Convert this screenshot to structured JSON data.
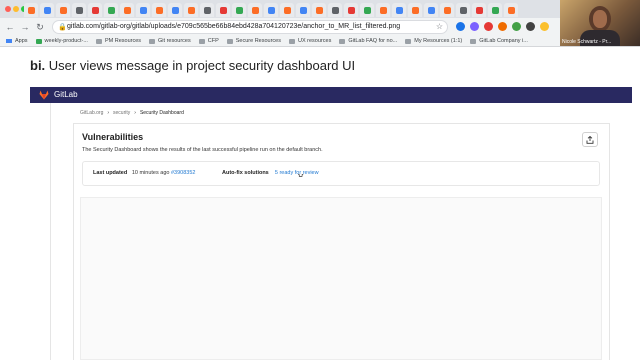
{
  "browser": {
    "url": "gitlab.com/gitlab-org/gitlab/uploads/e709c565be66b84ebd428a704120723e/anchor_to_MR_list_filtered.png",
    "bookmarks": [
      "Apps",
      "weekly-product-...",
      "PM Resources",
      "Git resources",
      "CFP",
      "Secure Resources",
      "UX resources",
      "GitLab FAQ for no...",
      "My Resources (1:1)",
      "GitLab Company i..."
    ],
    "tab_count": 31
  },
  "webcam": {
    "name": "Nicole Schwartz - Pr..."
  },
  "slide": {
    "number": "bi.",
    "title": "User views message in project security dashboard UI"
  },
  "gitlab": {
    "brand": "GitLab",
    "breadcrumb": [
      "GitLab.org",
      "security",
      "Security Dashboard"
    ],
    "heading": "Vulnerabilities",
    "description": "The Security Dashboard shows the results of the last successful pipeline run on the default branch.",
    "summary": {
      "last_updated_label": "Last updated",
      "last_updated_value": "10 minutes ago",
      "pipeline_link": "#3908352",
      "autofix_label": "Auto-fix solutions",
      "autofix_value": "5 ready for review"
    }
  },
  "colors": {
    "gitlab_nav": "#292961",
    "link": "#1f78d1",
    "tab_bar": "#dee1e6"
  }
}
